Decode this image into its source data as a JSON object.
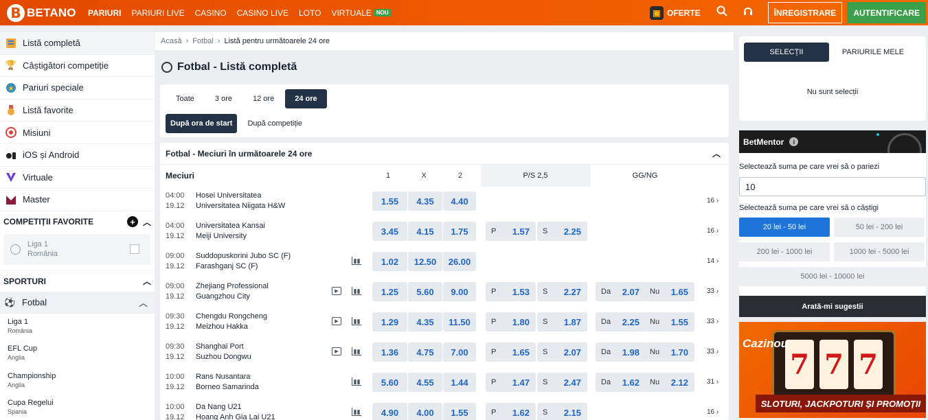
{
  "brand": {
    "name": "BETANO",
    "color": "#f05a00"
  },
  "nav": {
    "items": [
      {
        "label": "PARIURI",
        "active": true
      },
      {
        "label": "PARIURI LIVE"
      },
      {
        "label": "CASINO"
      },
      {
        "label": "CASINO LIVE"
      },
      {
        "label": "LOTO"
      },
      {
        "label": "VIRTUALE",
        "badge": "NOU"
      }
    ]
  },
  "top_right": {
    "oferte": "OFERTE",
    "register": "ÎNREGISTRARE",
    "login": "AUTENTIFICARE"
  },
  "sidebar": {
    "items": [
      {
        "label": "Listă completă",
        "icon": "list-icon"
      },
      {
        "label": "Câștigători competiție",
        "icon": "trophy-icon"
      },
      {
        "label": "Pariuri speciale",
        "icon": "star-icon"
      },
      {
        "label": "Listă favorite",
        "icon": "medal-icon"
      },
      {
        "label": "Misiuni",
        "icon": "target-icon"
      },
      {
        "label": "iOS și Android",
        "icon": "mobile-icon"
      },
      {
        "label": "Virtuale",
        "icon": "virtual-icon"
      },
      {
        "label": "Master",
        "icon": "master-icon"
      }
    ],
    "fav_title": "COMPETIȚII FAVORITE",
    "fav": {
      "name": "Liga 1",
      "country": "România"
    },
    "sports_title": "SPORTURI",
    "sport": "Fotbal",
    "leagues": [
      {
        "name": "Liga 1",
        "country": "România"
      },
      {
        "name": "EFL Cup",
        "country": "Anglia"
      },
      {
        "name": "Championship",
        "country": "Anglia"
      },
      {
        "name": "Cupa Regelui",
        "country": "Spania"
      }
    ]
  },
  "breadcrumb": [
    "Acasă",
    "Fotbal",
    "Listă pentru următoarele 24 ore"
  ],
  "page_title": "Fotbal - Listă completă",
  "time_tabs": [
    "Toate",
    "3 ore",
    "12 ore",
    "24 ore"
  ],
  "time_tab_active": "24 ore",
  "sort_tabs": [
    "După ora de start",
    "După competiție"
  ],
  "events_title": "Fotbal - Meciuri în următoarele 24 ore",
  "columns": {
    "matches": "Meciuri",
    "c1": "1",
    "cx": "X",
    "c2": "2",
    "ps": "P/S 2,5",
    "gg": "GG/NG"
  },
  "matches": [
    {
      "time": "04:00",
      "date": "19.12",
      "home": "Hosei Universitatea",
      "away": "Universitatea Niigata H&W",
      "tv": false,
      "stats": false,
      "o1": "1.55",
      "ox": "4.35",
      "o2": "4.40",
      "ps": null,
      "gg": null,
      "more": "16"
    },
    {
      "time": "04:00",
      "date": "19.12",
      "home": "Universitatea Kansai",
      "away": "Meiji University",
      "tv": false,
      "stats": false,
      "o1": "3.45",
      "ox": "4.15",
      "o2": "1.75",
      "ps": {
        "p": "1.57",
        "s": "2.25"
      },
      "gg": null,
      "more": "16"
    },
    {
      "time": "09:00",
      "date": "19.12",
      "home": "Suddopuskorini Jubo SC (F)",
      "away": "Farashganj SC (F)",
      "tv": false,
      "stats": true,
      "o1": "1.02",
      "ox": "12.50",
      "o2": "26.00",
      "ps": null,
      "gg": null,
      "more": "14"
    },
    {
      "time": "09:00",
      "date": "19.12",
      "home": "Zhejiang Professional",
      "away": "Guangzhou City",
      "tv": true,
      "stats": true,
      "o1": "1.25",
      "ox": "5.60",
      "o2": "9.00",
      "ps": {
        "p": "1.53",
        "s": "2.27"
      },
      "gg": {
        "da": "2.07",
        "nu": "1.65"
      },
      "more": "33"
    },
    {
      "time": "09:30",
      "date": "19.12",
      "home": "Chengdu Rongcheng",
      "away": "Meizhou Hakka",
      "tv": true,
      "stats": true,
      "o1": "1.29",
      "ox": "4.35",
      "o2": "11.50",
      "ps": {
        "p": "1.80",
        "s": "1.87"
      },
      "gg": {
        "da": "2.25",
        "nu": "1.55"
      },
      "more": "33"
    },
    {
      "time": "09:30",
      "date": "19.12",
      "home": "Shanghai Port",
      "away": "Suzhou Dongwu",
      "tv": true,
      "stats": true,
      "o1": "1.36",
      "ox": "4.75",
      "o2": "7.00",
      "ps": {
        "p": "1.65",
        "s": "2.07"
      },
      "gg": {
        "da": "1.98",
        "nu": "1.70"
      },
      "more": "33"
    },
    {
      "time": "10:00",
      "date": "19.12",
      "home": "Rans Nusantara",
      "away": "Borneo Samarinda",
      "tv": false,
      "stats": true,
      "o1": "5.60",
      "ox": "4.55",
      "o2": "1.44",
      "ps": {
        "p": "1.47",
        "s": "2.47"
      },
      "gg": {
        "da": "1.62",
        "nu": "2.12"
      },
      "more": "31"
    },
    {
      "time": "10:00",
      "date": "19.12",
      "home": "Da Nang U21",
      "away": "Hoang Anh Gia Lai U21",
      "tv": false,
      "stats": true,
      "o1": "4.90",
      "ox": "4.00",
      "o2": "1.55",
      "ps": {
        "p": "1.62",
        "s": "2.15"
      },
      "gg": null,
      "more": "16"
    }
  ],
  "labels": {
    "p": "P",
    "s": "S",
    "da": "Da",
    "nu": "Nu"
  },
  "betslip": {
    "tabs": [
      "SELECȚII",
      "PARIURILE MELE"
    ],
    "empty": "Nu sunt selecții"
  },
  "betmentor": {
    "title": "BetMentor",
    "stake_label": "Selectează suma pe care vrei să o pariezi",
    "stake_value": "10",
    "win_label": "Selectează suma pe care vrei să o câștigi",
    "amounts": [
      "20 lei - 50 lei",
      "50 lei - 200 lei",
      "200 lei - 1000 lei",
      "1000 lei - 5000 lei",
      "5000 lei - 10000 lei"
    ],
    "active_amount": "20 lei - 50 lei",
    "cta": "Arată-mi sugestii"
  },
  "casino": {
    "title": "Cazinou",
    "banner": "SLOTURI, JACKPOTURI ȘI PROMOȚII",
    "reels": [
      "7",
      "7",
      "7"
    ]
  }
}
